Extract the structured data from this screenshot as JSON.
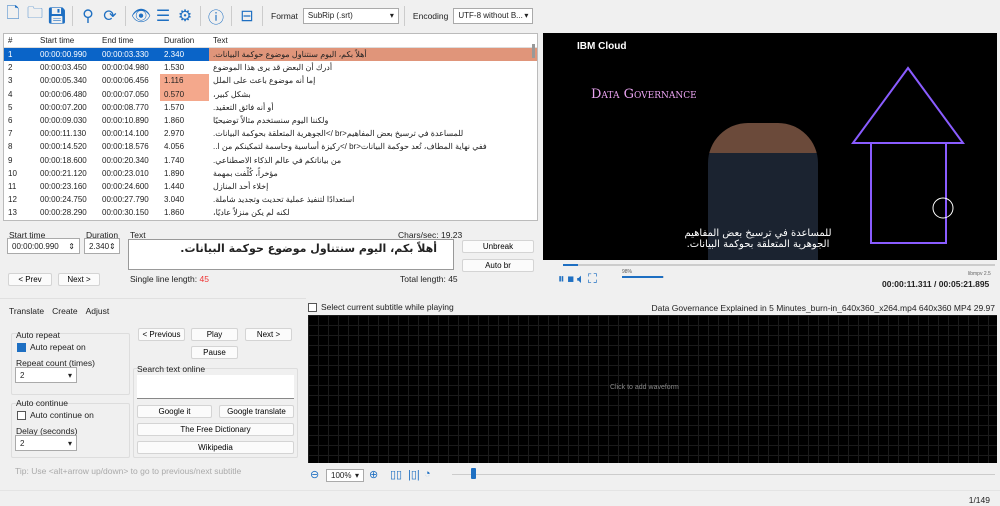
{
  "toolbar": {
    "format_label": "Format",
    "format_value": "SubRip (.srt)",
    "encoding_label": "Encoding",
    "encoding_value": "UTF-8 without B..."
  },
  "grid": {
    "headers": [
      "#",
      "Start time",
      "End time",
      "Duration",
      "Text"
    ],
    "rows": [
      [
        "1",
        "00:00:00.990",
        "00:00:03.330",
        "2.340",
        "أهلاً بكم، اليوم سنتناول موضوع حوكمة البيانات."
      ],
      [
        "2",
        "00:00:03.450",
        "00:00:04.980",
        "1.530",
        "أدرك أن البعض قد يرى هذا الموضوع"
      ],
      [
        "3",
        "00:00:05.340",
        "00:00:06.456",
        "1.116",
        "إما أنه موضوع باعث على الملل"
      ],
      [
        "4",
        "00:00:06.480",
        "00:00:07.050",
        "0.570",
        "بشكل كبير،"
      ],
      [
        "5",
        "00:00:07.200",
        "00:00:08.770",
        "1.570",
        "أو أنه فائق التعقيد."
      ],
      [
        "6",
        "00:00:09.030",
        "00:00:10.890",
        "1.860",
        "ولكننا اليوم سنستخدم مثالاً توضيحيًا"
      ],
      [
        "7",
        "00:00:11.130",
        "00:00:14.100",
        "2.970",
        "للمساعدة في ترسيخ بعض المفاهيم<br />الجوهرية المتعلقة بحوكمة البيانات."
      ],
      [
        "8",
        "00:00:14.520",
        "00:00:18.576",
        "4.056",
        "ففي نهاية المطاف، تُعد حوكمة البيانات<br />ركيزة أساسية وحاسمة لتمكينكم من ا.."
      ],
      [
        "9",
        "00:00:18.600",
        "00:00:20.340",
        "1.740",
        "من بياناتكم في عالم الذكاء الاصطناعي."
      ],
      [
        "10",
        "00:00:21.120",
        "00:00:23.010",
        "1.890",
        "مؤخراً، كُلِّفت بمهمة"
      ],
      [
        "11",
        "00:00:23.160",
        "00:00:24.600",
        "1.440",
        "إخلاء أحد المنازل"
      ],
      [
        "12",
        "00:00:24.750",
        "00:00:27.790",
        "3.040",
        "استعدادًا لتنفيذ عملية تحديث وتجديد شاملة."
      ],
      [
        "13",
        "00:00:28.290",
        "00:00:30.150",
        "1.860",
        "لكنه لم يكن منزلاً عاديًا،"
      ]
    ]
  },
  "edit": {
    "start_label": "Start time",
    "start_value": "00:00:00.990",
    "duration_label": "Duration",
    "duration_value": "2.340",
    "text_label": "Text",
    "chars_sec": "Chars/sec: 19.23",
    "text_value": "أهلاً بكم، اليوم سنتناول موضوع حوكمة البيانات.",
    "single_line_label": "Single line length:",
    "single_line_value": "45",
    "total_length": "Total length: 45",
    "prev": "< Prev",
    "next": "Next >",
    "unbreak": "Unbreak",
    "auto_br": "Auto br"
  },
  "video": {
    "brand": "IBM Cloud",
    "title": "Data Governance",
    "sub1": "للمساعدة في ترسيخ بعض المفاهيم",
    "sub2": "الجوهرية المتعلقة بحوكمة البيانات.",
    "volume": "98%",
    "engine": "libmpv 2.5",
    "time": "00:00:11.311 / 00:05:21.895",
    "progress": 0.035,
    "volume_level": 0.98
  },
  "tabs": [
    "Translate",
    "Create",
    "Adjust"
  ],
  "translate": {
    "auto_repeat": "Auto repeat",
    "auto_repeat_on": "Auto repeat on",
    "repeat_count": "Repeat count (times)",
    "repeat_value": "2",
    "auto_continue": "Auto continue",
    "auto_continue_on": "Auto continue on",
    "delay": "Delay (seconds)",
    "delay_value": "2",
    "previous": "< Previous",
    "play": "Play",
    "next": "Next >",
    "pause": "Pause",
    "search_label": "Search text online",
    "google_it": "Google it",
    "google_translate": "Google translate",
    "free_dict": "The Free Dictionary",
    "wikipedia": "Wikipedia",
    "tip": "Tip: Use <alt+arrow up/down> to go to previous/next subtitle"
  },
  "waveform": {
    "select_current": "Select current subtitle while playing",
    "file_info": "Data Governance Explained in 5 Minutes_burn-in_640x360_x264.mp4 640x360 MP4 29.97",
    "click_hint": "Click to add waveform",
    "zoom": "100%"
  },
  "status": {
    "position": "1/149"
  }
}
